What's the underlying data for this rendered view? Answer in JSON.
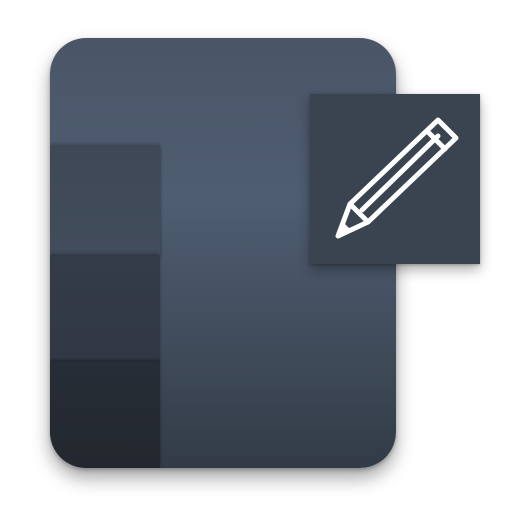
{
  "icon": {
    "kind": "document-with-edit-badge",
    "badge_icon": "pencil-icon",
    "colors": {
      "tile_top": "#4a5667",
      "tile_bottom": "#323b47",
      "strip_light": "#404a59",
      "strip_mid": "#333a45",
      "strip_dark": "#252a32",
      "badge_bg": "#3a4350",
      "pencil_stroke": "#ffffff"
    }
  }
}
